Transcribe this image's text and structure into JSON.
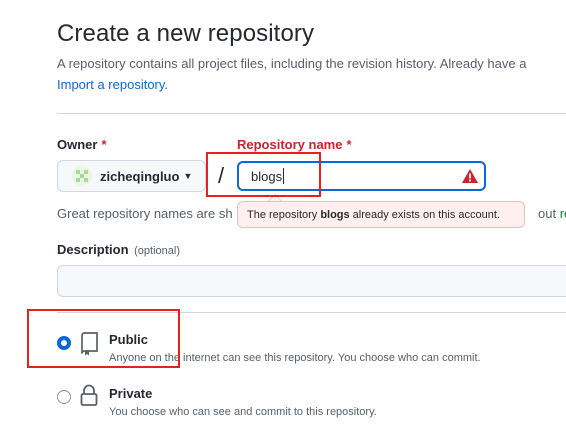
{
  "header": {
    "title": "Create a new repository",
    "subtitle": "A repository contains all project files, including the revision history. Already have a",
    "import_link": "Import a repository."
  },
  "form": {
    "owner_label": "Owner",
    "required_mark": "*",
    "owner_value": "zicheqingluo",
    "separator": "/",
    "repo_label": "Repository name",
    "repo_value": "blogs",
    "hint_start": "Great repository names are sh",
    "hint_end_text": "out",
    "hint_end_link": "re",
    "tooltip_before": "The repository",
    "tooltip_repo": "blogs",
    "tooltip_after": "already exists on this account.",
    "description_label": "Description",
    "description_optional": "(optional)",
    "description_value": ""
  },
  "visibility": {
    "options": [
      {
        "label": "Public",
        "description": "Anyone on the internet can see this repository. You choose who can commit.",
        "checked": true,
        "icon": "repo-icon"
      },
      {
        "label": "Private",
        "description": "You choose who can see and commit to this repository.",
        "checked": false,
        "icon": "lock-icon"
      }
    ]
  },
  "colors": {
    "accent": "#0969da",
    "danger": "#cf222e",
    "annotation": "#e8211d"
  }
}
